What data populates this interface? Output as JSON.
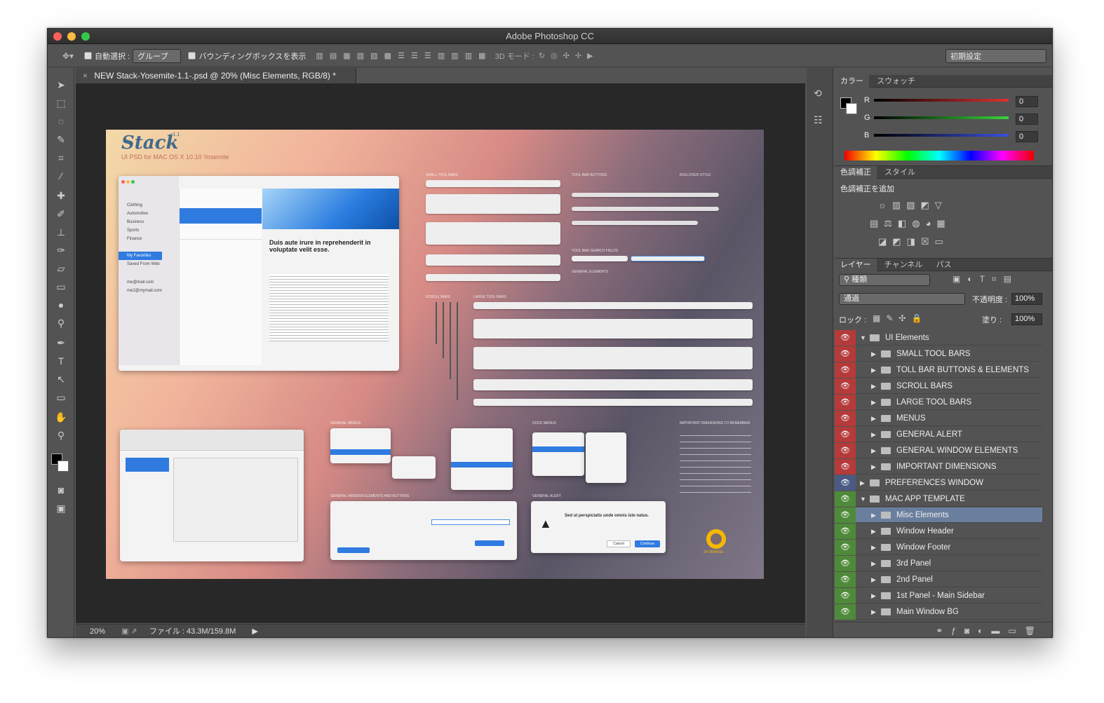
{
  "window": {
    "title": "Adobe Photoshop CC"
  },
  "options_bar": {
    "auto_select_label": "自動選択 :",
    "auto_select_value": "グループ",
    "bbox_label": "バウンディングボックスを表示",
    "mode3d_label": "3D モード :",
    "workspace_value": "初期設定"
  },
  "document": {
    "tab_title": "NEW Stack-Yosemite-1.1-.psd @ 20% (Misc Elements, RGB/8) *",
    "close_glyph": "×"
  },
  "status": {
    "zoom": "20%",
    "file_info": "ファイル : 43.3M/159.8M"
  },
  "artboard": {
    "logo": "Stack",
    "version": "v1.1",
    "subtitle": "UI PSD for MAC OS X 10.10 Yosemite",
    "section_labels": [
      "SMALL TOOL BARS",
      "TOOL BAR BUTTONS",
      "ROLLOVER STYLE",
      "TOOL BAR SEARCH FIELDS",
      "GENERAL ELEMENTS",
      "SCROLL BARS",
      "LARGE TOOL BARS",
      "GENERAL MENUS",
      "DOCK MENUS",
      "IMPORTANT DIMENSIONS TO REMEMBER",
      "GENERAL WINDOW ELEMENTS AND BUTTONS",
      "GENERAL ALERT"
    ],
    "sidebar_items": [
      "Clothing",
      "Automotive",
      "Business",
      "Sports",
      "Finance",
      "My Favorites",
      "Saved From Web",
      "me@mail.com",
      "me2@mymail.com"
    ],
    "article_title": "Duis aute irure in reprehenderit in voluptate velit esse.",
    "alert_title": "Sed ut perspiciatis unde omnis iste natus.",
    "alert_cancel": "Cancel",
    "alert_continue": "Continue",
    "brand_footer": "24 ORANGE"
  },
  "color_panel": {
    "tabs": [
      "カラー",
      "スウォッチ"
    ],
    "channels": [
      {
        "label": "R",
        "value": "0",
        "color": "#d43a3a"
      },
      {
        "label": "G",
        "value": "0",
        "color": "#39b53a"
      },
      {
        "label": "B",
        "value": "0",
        "color": "#3a4fd4"
      }
    ]
  },
  "adjust_panel": {
    "tabs": [
      "色調補正",
      "スタイル"
    ],
    "add_label": "色調補正を追加"
  },
  "layers_panel": {
    "tabs": [
      "レイヤー",
      "チャンネル",
      "パス"
    ],
    "kind_filter": "種類",
    "blend_mode": "通過",
    "opacity_label": "不透明度 :",
    "opacity_value": "100%",
    "lock_label": "ロック :",
    "fill_label": "塗り :",
    "fill_value": "100%",
    "layers": [
      {
        "name": "UI Elements",
        "color": "#b53a3a",
        "indent": 0,
        "open": true,
        "selected": false
      },
      {
        "name": "SMALL TOOL BARS",
        "color": "#b53a3a",
        "indent": 1,
        "open": false,
        "selected": false
      },
      {
        "name": "TOLL BAR BUTTONS & ELEMENTS",
        "color": "#b53a3a",
        "indent": 1,
        "open": false,
        "selected": false
      },
      {
        "name": "SCROLL BARS",
        "color": "#b53a3a",
        "indent": 1,
        "open": false,
        "selected": false
      },
      {
        "name": "LARGE TOOL BARS",
        "color": "#b53a3a",
        "indent": 1,
        "open": false,
        "selected": false
      },
      {
        "name": "MENUS",
        "color": "#b53a3a",
        "indent": 1,
        "open": false,
        "selected": false
      },
      {
        "name": "GENERAL ALERT",
        "color": "#b53a3a",
        "indent": 1,
        "open": false,
        "selected": false
      },
      {
        "name": "GENERAL WINDOW ELEMENTS",
        "color": "#b53a3a",
        "indent": 1,
        "open": false,
        "selected": false
      },
      {
        "name": "IMPORTANT DIMENSIONS",
        "color": "#b53a3a",
        "indent": 1,
        "open": false,
        "selected": false
      },
      {
        "name": "PREFERENCES WINDOW",
        "color": "#4a5a82",
        "indent": 0,
        "open": false,
        "selected": false
      },
      {
        "name": "MAC APP TEMPLATE",
        "color": "#4f8a3a",
        "indent": 0,
        "open": true,
        "selected": false
      },
      {
        "name": "Misc Elements",
        "color": "#4f8a3a",
        "indent": 1,
        "open": false,
        "selected": true
      },
      {
        "name": "Window Header",
        "color": "#4f8a3a",
        "indent": 1,
        "open": false,
        "selected": false
      },
      {
        "name": "Window Footer",
        "color": "#4f8a3a",
        "indent": 1,
        "open": false,
        "selected": false
      },
      {
        "name": "3rd Panel",
        "color": "#4f8a3a",
        "indent": 1,
        "open": false,
        "selected": false
      },
      {
        "name": "2nd Panel",
        "color": "#4f8a3a",
        "indent": 1,
        "open": false,
        "selected": false
      },
      {
        "name": "1st Panel - Main Sidebar",
        "color": "#4f8a3a",
        "indent": 1,
        "open": false,
        "selected": false
      },
      {
        "name": "Main Window BG",
        "color": "#4f8a3a",
        "indent": 1,
        "open": false,
        "selected": false
      }
    ]
  }
}
